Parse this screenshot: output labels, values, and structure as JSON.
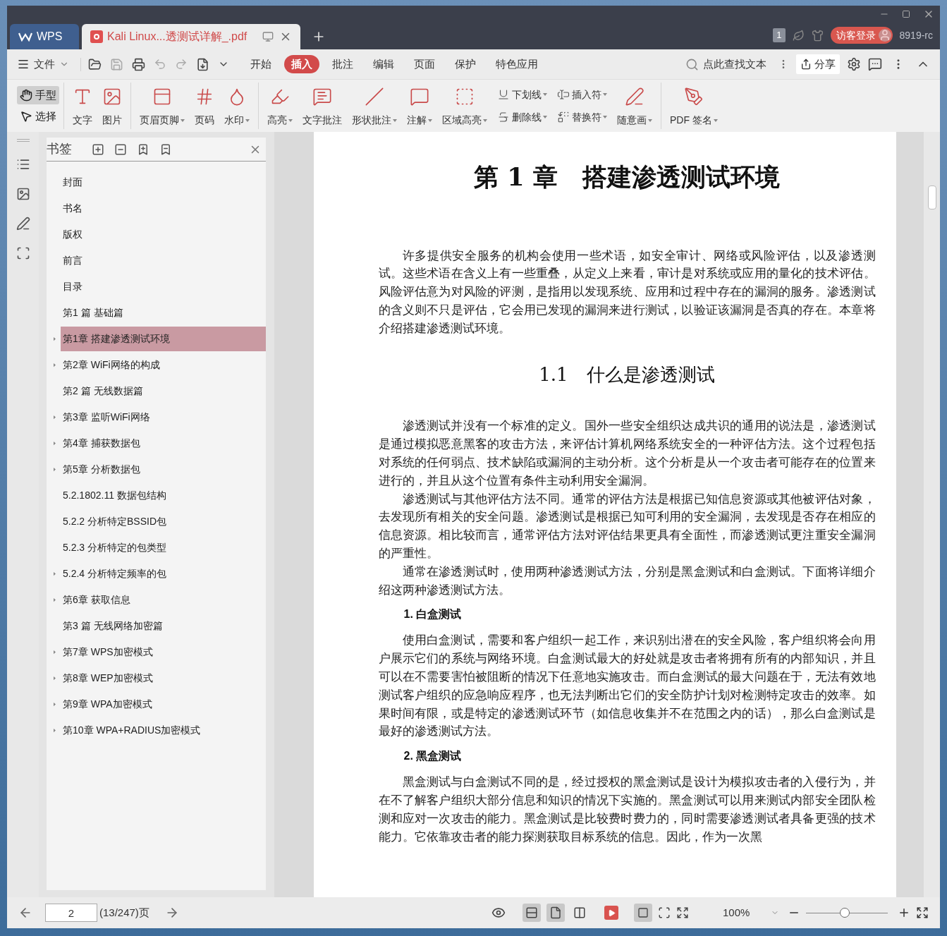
{
  "window": {
    "tabs": [
      {
        "label": "WPS",
        "kind": "home",
        "selected": false
      },
      {
        "label": "Kali Linux...透测试详解_.pdf",
        "kind": "document",
        "selected": true
      }
    ],
    "badge": "1",
    "login": "访客登录",
    "user": "8919-rc"
  },
  "menu": {
    "file": "文件",
    "tabs": [
      {
        "label": "开始",
        "selected": false
      },
      {
        "label": "插入",
        "selected": true
      },
      {
        "label": "批注",
        "selected": false
      },
      {
        "label": "编辑",
        "selected": false
      },
      {
        "label": "页面",
        "selected": false
      },
      {
        "label": "保护",
        "selected": false
      },
      {
        "label": "特色应用",
        "selected": false
      }
    ],
    "search": {
      "placeholder": "点此查找文本"
    },
    "share": "分享"
  },
  "ribbon": {
    "modes": [
      {
        "label": "手型",
        "selected": true
      },
      {
        "label": "选择",
        "selected": false
      }
    ],
    "groups": [
      [
        {
          "label": "文字",
          "kind": "big",
          "dropdown": false
        },
        {
          "label": "图片",
          "kind": "big",
          "dropdown": false
        }
      ],
      [
        {
          "label": "页眉页脚",
          "kind": "big",
          "dropdown": true
        },
        {
          "label": "页码",
          "kind": "big",
          "dropdown": false
        },
        {
          "label": "水印",
          "kind": "big",
          "dropdown": true
        }
      ],
      [
        {
          "label": "高亮",
          "kind": "big",
          "dropdown": true
        },
        {
          "label": "文字批注",
          "kind": "big",
          "dropdown": false
        },
        {
          "label": "形状批注",
          "kind": "big",
          "dropdown": true
        },
        {
          "label": "注解",
          "kind": "big",
          "dropdown": true
        },
        {
          "label": "区域高亮",
          "kind": "big",
          "dropdown": true
        },
        {
          "label": "下划线",
          "kind": "small",
          "dropdown": true
        },
        {
          "label": "删除线",
          "kind": "small",
          "dropdown": true
        },
        {
          "label": "插入符",
          "kind": "small",
          "dropdown": true
        },
        {
          "label": "替换符",
          "kind": "small",
          "dropdown": true
        },
        {
          "label": "随意画",
          "kind": "big",
          "dropdown": true
        }
      ],
      [
        {
          "label": "PDF 签名",
          "kind": "big",
          "dropdown": true
        }
      ]
    ]
  },
  "bookmarks": {
    "title": "书签",
    "items": [
      {
        "label": "封面",
        "expandable": false,
        "selected": false
      },
      {
        "label": "书名",
        "expandable": false,
        "selected": false
      },
      {
        "label": "版权",
        "expandable": false,
        "selected": false
      },
      {
        "label": "前言",
        "expandable": false,
        "selected": false
      },
      {
        "label": "目录",
        "expandable": false,
        "selected": false
      },
      {
        "label": "第1 篇 基础篇",
        "expandable": false,
        "selected": false
      },
      {
        "label": "第1章 搭建渗透测试环境",
        "expandable": true,
        "selected": true
      },
      {
        "label": "第2章 WiFi网络的构成",
        "expandable": true,
        "selected": false
      },
      {
        "label": "第2 篇 无线数据篇",
        "expandable": false,
        "selected": false
      },
      {
        "label": "第3章 监听WiFi网络",
        "expandable": true,
        "selected": false
      },
      {
        "label": "第4章 捕获数据包",
        "expandable": true,
        "selected": false
      },
      {
        "label": "第5章 分析数据包",
        "expandable": true,
        "selected": false
      },
      {
        "label": "5.2.1802.11 数据包结构",
        "expandable": false,
        "selected": false
      },
      {
        "label": "5.2.2 分析特定BSSID包",
        "expandable": false,
        "selected": false
      },
      {
        "label": "5.2.3 分析特定的包类型",
        "expandable": false,
        "selected": false
      },
      {
        "label": "5.2.4 分析特定频率的包",
        "expandable": true,
        "selected": false
      },
      {
        "label": "第6章 获取信息",
        "expandable": true,
        "selected": false
      },
      {
        "label": "第3 篇 无线网络加密篇",
        "expandable": false,
        "selected": false
      },
      {
        "label": "第7章 WPS加密模式",
        "expandable": true,
        "selected": false
      },
      {
        "label": "第8章 WEP加密模式",
        "expandable": true,
        "selected": false
      },
      {
        "label": "第9章 WPA加密模式",
        "expandable": true,
        "selected": false
      },
      {
        "label": "第10章 WPA+RADIUS加密模式",
        "expandable": true,
        "selected": false
      }
    ]
  },
  "document": {
    "blocks": [
      {
        "kind": "chapter",
        "text": "第 1 章　搭建渗透测试环境"
      },
      {
        "kind": "paragraph",
        "text": "许多提供安全服务的机构会使用一些术语，如安全审计、网络或风险评估，以及渗透测试。这些术语在含义上有一些重叠，从定义上来看，审计是对系统或应用的量化的技术评估。风险评估意为对风险的评测，是指用以发现系统、应用和过程中存在的漏洞的服务。渗透测试的含义则不只是评估，它会用已发现的漏洞来进行测试，以验证该漏洞是否真的存在。本章将介绍搭建渗透测试环境。"
      },
      {
        "kind": "section",
        "text": "1.1　什么是渗透测试"
      },
      {
        "kind": "paragraph",
        "text": "渗透测试并没有一个标准的定义。国外一些安全组织达成共识的通用的说法是，渗透测试是通过模拟恶意黑客的攻击方法，来评估计算机网络系统安全的一种评估方法。这个过程包括对系统的任何弱点、技术缺陷或漏洞的主动分析。这个分析是从一个攻击者可能存在的位置来进行的，并且从这个位置有条件主动利用安全漏洞。"
      },
      {
        "kind": "paragraph",
        "text": "渗透测试与其他评估方法不同。通常的评估方法是根据已知信息资源或其他被评估对象，去发现所有相关的安全问题。渗透测试是根据已知可利用的安全漏洞，去发现是否存在相应的信息资源。相比较而言，通常评估方法对评估结果更具有全面性，而渗透测试更注重安全漏洞的严重性。"
      },
      {
        "kind": "paragraph",
        "text": "通常在渗透测试时，使用两种渗透测试方法，分别是黑盒测试和白盒测试。下面将详细介绍这两种渗透测试方法。"
      },
      {
        "kind": "subheading",
        "text": "1. 白盒测试"
      },
      {
        "kind": "paragraph",
        "text": "使用白盒测试，需要和客户组织一起工作，来识别出潜在的安全风险，客户组织将会向用户展示它们的系统与网络环境。白盒测试最大的好处就是攻击者将拥有所有的内部知识，并且可以在不需要害怕被阻断的情况下任意地实施攻击。而白盒测试的最大问题在于，无法有效地测试客户组织的应急响应程序，也无法判断出它们的安全防护计划对检测特定攻击的效率。如果时间有限，或是特定的渗透测试环节（如信息收集并不在范围之内的话），那么白盒测试是最好的渗透测试方法。"
      },
      {
        "kind": "subheading",
        "text": "2. 黑盒测试"
      },
      {
        "kind": "paragraph",
        "text": "黑盒测试与白盒测试不同的是，经过授权的黑盒测试是设计为模拟攻击者的入侵行为，并在不了解客户组织大部分信息和知识的情况下实施的。黑盒测试可以用来测试内部安全团队检测和应对一次攻击的能力。黑盒测试是比较费时费力的，同时需要渗透测试者具备更强的技术能力。它依靠攻击者的能力探测获取目标系统的信息。因此，作为一次黑"
      }
    ]
  },
  "status_bar": {
    "page": "2",
    "page_count": "(13/247)页",
    "layouts": [
      {
        "selected": true
      },
      {
        "selected": true
      },
      {
        "selected": false
      }
    ],
    "actual_size": {
      "selected": true
    },
    "zoom": "100%",
    "zoom_slider": {
      "level": 0.47
    }
  }
}
